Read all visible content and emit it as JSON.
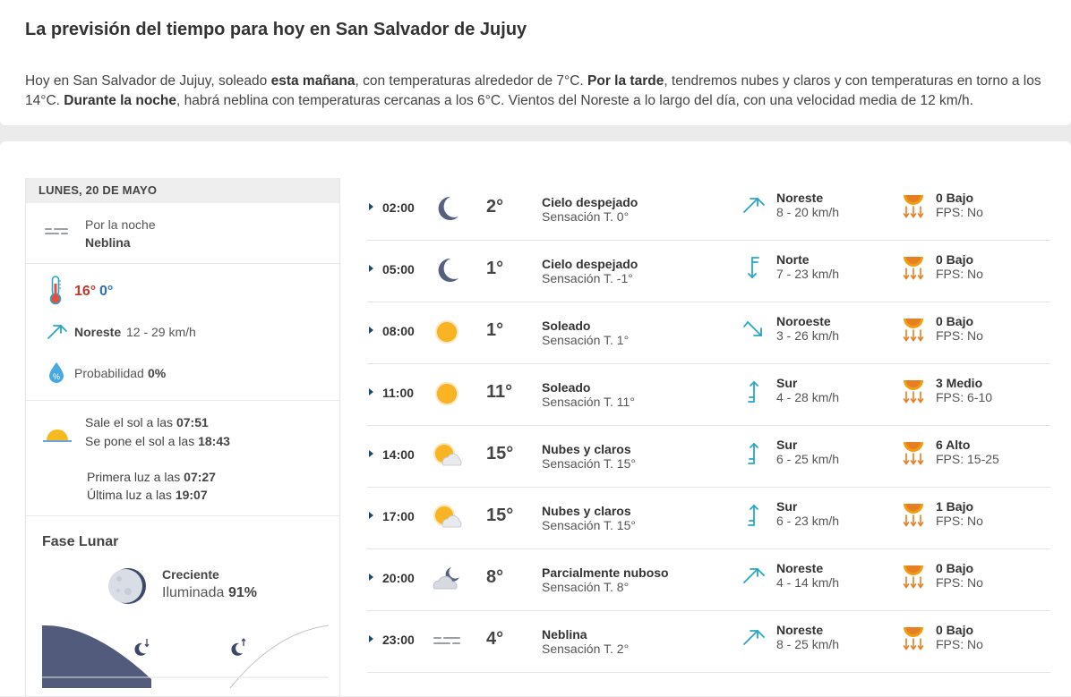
{
  "summary": {
    "title": "La previsión del tiempo para hoy en San Salvador de Jujuy",
    "desc_1": "Hoy en San Salvador de Jujuy, soleado ",
    "desc_b1": "esta mañana",
    "desc_2": ", con temperaturas alrededor de 7°C. ",
    "desc_b2": "Por la tarde",
    "desc_3": ", tendremos nubes y claros y con temperaturas en torno a los 14°C. ",
    "desc_b3": "Durante la noche",
    "desc_4": ", habrá neblina con temperaturas cercanas a los 6°C. Vientos del Noreste a lo largo del día, con una velocidad media de 12 km/h."
  },
  "day": {
    "header": "LUNES, 20 DE MAYO",
    "night_label": "Por la noche",
    "night_value": "Neblina",
    "temp_max": "16°",
    "temp_min": "0°",
    "wind_dir": "Noreste",
    "wind_speed": "12 - 29 km/h",
    "prob_label": "Probabilidad",
    "prob_value": "0%",
    "sunrise_label": "Sale el sol a las",
    "sunrise": "07:51",
    "sunset_label": "Se pone el sol a las",
    "sunset": "18:43",
    "first_light_label": "Primera luz a las",
    "first_light": "07:27",
    "last_light_label": "Última luz a las",
    "last_light": "19:07",
    "moon_title": "Fase Lunar",
    "moon_phase": "Creciente",
    "moon_illum_label": "Iluminada",
    "moon_illum": "91%"
  },
  "hours": [
    {
      "time": "02:00",
      "icon": "moon-icon",
      "temp": "2°",
      "cond": "Cielo despejado",
      "feel": "Sensación T. 0°",
      "wind_dir": "Noreste",
      "wind_icon": "wind-northeast-icon",
      "wind": "8 - 20 km/h",
      "uv": "0 Bajo",
      "fps": "FPS: No"
    },
    {
      "time": "05:00",
      "icon": "moon-icon",
      "temp": "1°",
      "cond": "Cielo despejado",
      "feel": "Sensación T. -1°",
      "wind_dir": "Norte",
      "wind_icon": "wind-north-icon",
      "wind": "7 - 23 km/h",
      "uv": "0 Bajo",
      "fps": "FPS: No"
    },
    {
      "time": "08:00",
      "icon": "sun-icon",
      "temp": "1°",
      "cond": "Soleado",
      "feel": "Sensación T. 1°",
      "wind_dir": "Noroeste",
      "wind_icon": "wind-northwest-icon",
      "wind": "3 - 26 km/h",
      "uv": "0 Bajo",
      "fps": "FPS: No"
    },
    {
      "time": "11:00",
      "icon": "sun-icon",
      "temp": "11°",
      "cond": "Soleado",
      "feel": "Sensación T. 11°",
      "wind_dir": "Sur",
      "wind_icon": "wind-south-icon",
      "wind": "4 - 28 km/h",
      "uv": "3 Medio",
      "fps": "FPS: 6-10"
    },
    {
      "time": "14:00",
      "icon": "sun-cloud-icon",
      "temp": "15°",
      "cond": "Nubes y claros",
      "feel": "Sensación T. 15°",
      "wind_dir": "Sur",
      "wind_icon": "wind-south-icon",
      "wind": "6 - 25 km/h",
      "uv": "6 Alto",
      "fps": "FPS: 15-25"
    },
    {
      "time": "17:00",
      "icon": "sun-cloud-icon",
      "temp": "15°",
      "cond": "Nubes y claros",
      "feel": "Sensación T. 15°",
      "wind_dir": "Sur",
      "wind_icon": "wind-south-icon",
      "wind": "6 - 23 km/h",
      "uv": "1 Bajo",
      "fps": "FPS: No"
    },
    {
      "time": "20:00",
      "icon": "moon-cloud-icon",
      "temp": "8°",
      "cond": "Parcialmente nuboso",
      "feel": "Sensación T. 8°",
      "wind_dir": "Noreste",
      "wind_icon": "wind-northeast-icon",
      "wind": "4 - 14 km/h",
      "uv": "0 Bajo",
      "fps": "FPS: No"
    },
    {
      "time": "23:00",
      "icon": "fog-icon",
      "temp": "4°",
      "cond": "Neblina",
      "feel": "Sensación T. 2°",
      "wind_dir": "Noreste",
      "wind_icon": "wind-northeast-icon",
      "wind": "8 - 25 km/h",
      "uv": "0 Bajo",
      "fps": "FPS: No"
    }
  ]
}
